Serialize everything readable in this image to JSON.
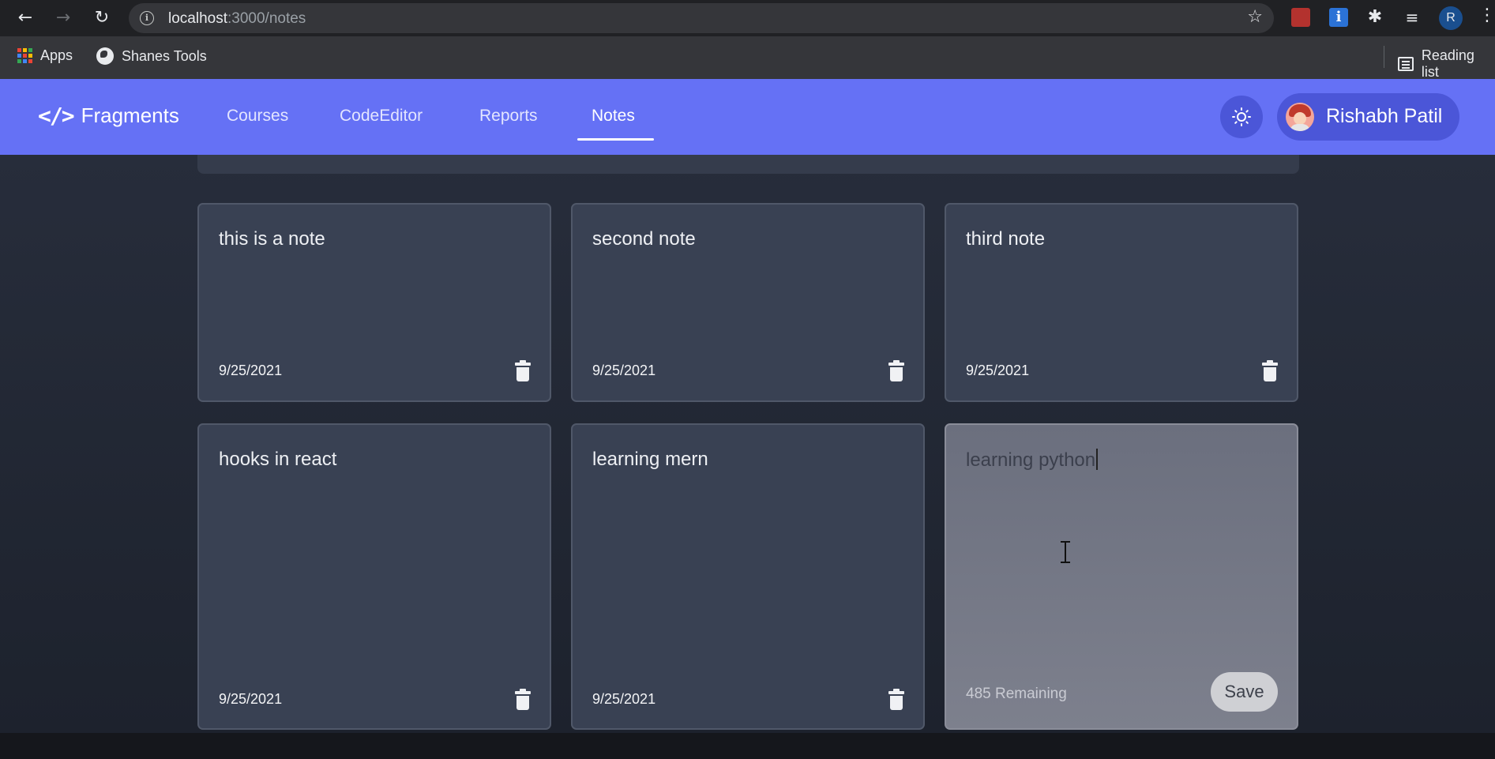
{
  "browser": {
    "url_host": "localhost",
    "url_path": ":3000/notes",
    "bookmarks": [
      {
        "label": "Apps"
      },
      {
        "label": "Shanes Tools"
      }
    ],
    "reading_list_label": "Reading list",
    "profile_initial": "R"
  },
  "navbar": {
    "brand_icon": "</>",
    "brand_name": "Fragments",
    "links": [
      {
        "label": "Courses"
      },
      {
        "label": "CodeEditor"
      },
      {
        "label": "Reports"
      },
      {
        "label": "Notes"
      }
    ],
    "active_link": "Notes",
    "user_name": "Rishabh Patil",
    "accent_color": "#6571f5"
  },
  "notes": [
    {
      "text": "this is a note",
      "date": "9/25/2021"
    },
    {
      "text": "second note",
      "date": "9/25/2021"
    },
    {
      "text": "third note",
      "date": "9/25/2021"
    },
    {
      "text": "hooks in react",
      "date": "9/25/2021"
    },
    {
      "text": "learning mern",
      "date": "9/25/2021"
    }
  ],
  "new_note": {
    "value": "learning python",
    "remaining_label": "485 Remaining",
    "save_label": "Save"
  }
}
